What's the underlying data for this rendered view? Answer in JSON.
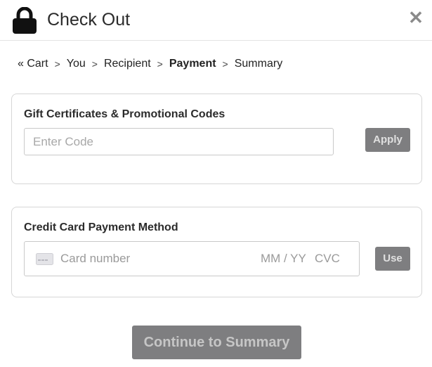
{
  "header": {
    "title": "Check Out",
    "close_glyph": "✕",
    "icons": {
      "lock": "lock-icon",
      "close": "close-icon"
    }
  },
  "breadcrumb": {
    "items": [
      {
        "label": "« Cart"
      },
      {
        "label": "You"
      },
      {
        "label": "Recipient"
      },
      {
        "label": "Payment",
        "active": true
      },
      {
        "label": "Summary"
      }
    ],
    "separator": ">"
  },
  "gift_panel": {
    "title": "Gift Certificates & Promotional Codes",
    "code_placeholder": "Enter Code",
    "code_value": "",
    "apply_label": "Apply"
  },
  "card_panel": {
    "title": "Credit Card Payment Method",
    "card_number_placeholder": "Card number",
    "expiry_placeholder": "MM / YY",
    "cvc_placeholder": "CVC",
    "use_label": "Use",
    "icons": {
      "card": "credit-card-icon"
    }
  },
  "footer": {
    "continue_label": "Continue to Summary"
  },
  "colors": {
    "button_bg": "#7e7e80",
    "border": "#d6d6d6",
    "text": "#2b2b2b"
  }
}
